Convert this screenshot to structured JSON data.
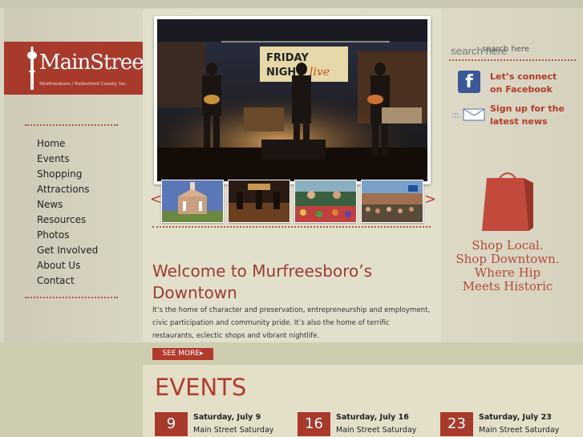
{
  "logo": {
    "title": "MainStreet",
    "subtitle": "Murfreesboro / Rutherford County, Inc."
  },
  "nav": [
    "Home",
    "Events",
    "Shopping",
    "Attractions",
    "News",
    "Resources",
    "Photos",
    "Get Involved",
    "About Us",
    "Contact"
  ],
  "hero": {
    "banner_text": "FRIDAY NIGHT live",
    "prev_arrow": "<",
    "next_arrow": ">",
    "welcome": "Welcome to Murfreesboro’s Downtown",
    "intro": "It’s the home of character and preservation, entrepreneurship and employment, civic participation and community pride. It’s also the home of terrific restaurants, eclectic shops and vibrant nightlife.",
    "see_more": "SEE MORE▸"
  },
  "right": {
    "search_placeholder": "search here",
    "facebook": "Let’s connect on Facebook",
    "signup": "Sign up for the latest news",
    "shop_local": "Shop Local. Shop Downtown. Where Hip Meets Historic"
  },
  "events": {
    "title": "EVENTS",
    "items": [
      {
        "date": "9",
        "day": "Saturday, July 9",
        "name": "Main Street Saturday"
      },
      {
        "date": "16",
        "day": "Saturday, July 16",
        "name": "Main Street Saturday"
      },
      {
        "date": "23",
        "day": "Saturday, July 23",
        "name": "Main Street Saturday"
      }
    ]
  },
  "icons": {
    "facebook": "facebook-icon",
    "mail": "mail-icon",
    "bag": "shopping-bag-icon",
    "tower": "water-tower-icon"
  },
  "colors": {
    "brand_red": "#a83a2c",
    "link_red": "#b23a2c",
    "facebook_blue": "#3b5998"
  }
}
